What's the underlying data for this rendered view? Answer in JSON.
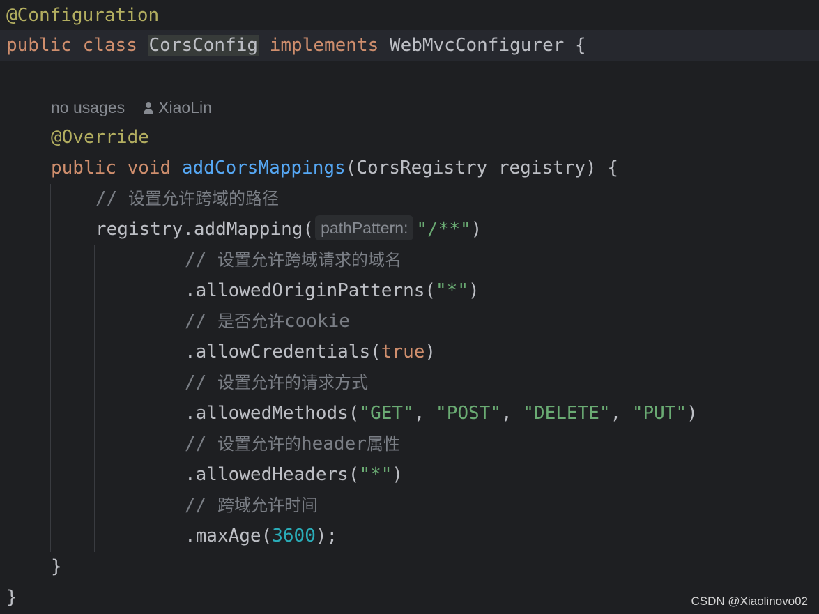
{
  "code": {
    "l1": {
      "annotation": "@Configuration"
    },
    "l2": {
      "kw_public": "public",
      "kw_class": "class",
      "class_name": "CorsConfig",
      "kw_implements": "implements",
      "interface": "WebMvcConfigurer",
      "brace": "{"
    },
    "meta": {
      "usages": "no usages",
      "author": "XiaoLin"
    },
    "l4": {
      "annotation": "@Override"
    },
    "l5": {
      "kw_public": "public",
      "kw_void": "void",
      "method": "addCorsMappings",
      "params": "(CorsRegistry registry) {"
    },
    "l6": {
      "comment": "// ",
      "comment_text": "设置允许跨域的路径"
    },
    "l7": {
      "call": "registry.addMapping(",
      "hint": "pathPattern:",
      "arg": "\"/**\"",
      "close": ")"
    },
    "l8": {
      "comment": "// ",
      "comment_text": "设置允许跨域请求的域名"
    },
    "l9": {
      "call": ".allowedOriginPatterns(",
      "arg": "\"*\"",
      "close": ")"
    },
    "l10": {
      "comment": "// ",
      "comment_text": "是否允许",
      "comment_tail": "cookie"
    },
    "l11": {
      "call": ".allowCredentials(",
      "arg": "true",
      "close": ")"
    },
    "l12": {
      "comment": "// ",
      "comment_text": "设置允许的请求方式"
    },
    "l13": {
      "call": ".allowedMethods(",
      "a1": "\"GET\"",
      "sep1": ", ",
      "a2": "\"POST\"",
      "sep2": ", ",
      "a3": "\"DELETE\"",
      "sep3": ", ",
      "a4": "\"PUT\"",
      "close": ")"
    },
    "l14": {
      "comment": "// ",
      "comment_text": "设置允许的",
      "comment_mid": "header",
      "comment_tail": "属性"
    },
    "l15": {
      "call": ".allowedHeaders(",
      "arg": "\"*\"",
      "close": ")"
    },
    "l16": {
      "comment": "// ",
      "comment_text": "跨域允许时间"
    },
    "l17": {
      "call": ".maxAge(",
      "arg": "3600",
      "close": ");"
    },
    "l18": {
      "brace": "}"
    },
    "l19": {
      "brace": "}"
    }
  },
  "watermark": "CSDN @Xiaolinovo02",
  "colors": {
    "background": "#1e1f22",
    "keyword": "#cf8e6d",
    "annotation": "#b3ae60",
    "method": "#56a8f5",
    "string": "#6aab73",
    "number": "#2aacb8",
    "comment": "#7a7e85",
    "text": "#bcbec4"
  }
}
